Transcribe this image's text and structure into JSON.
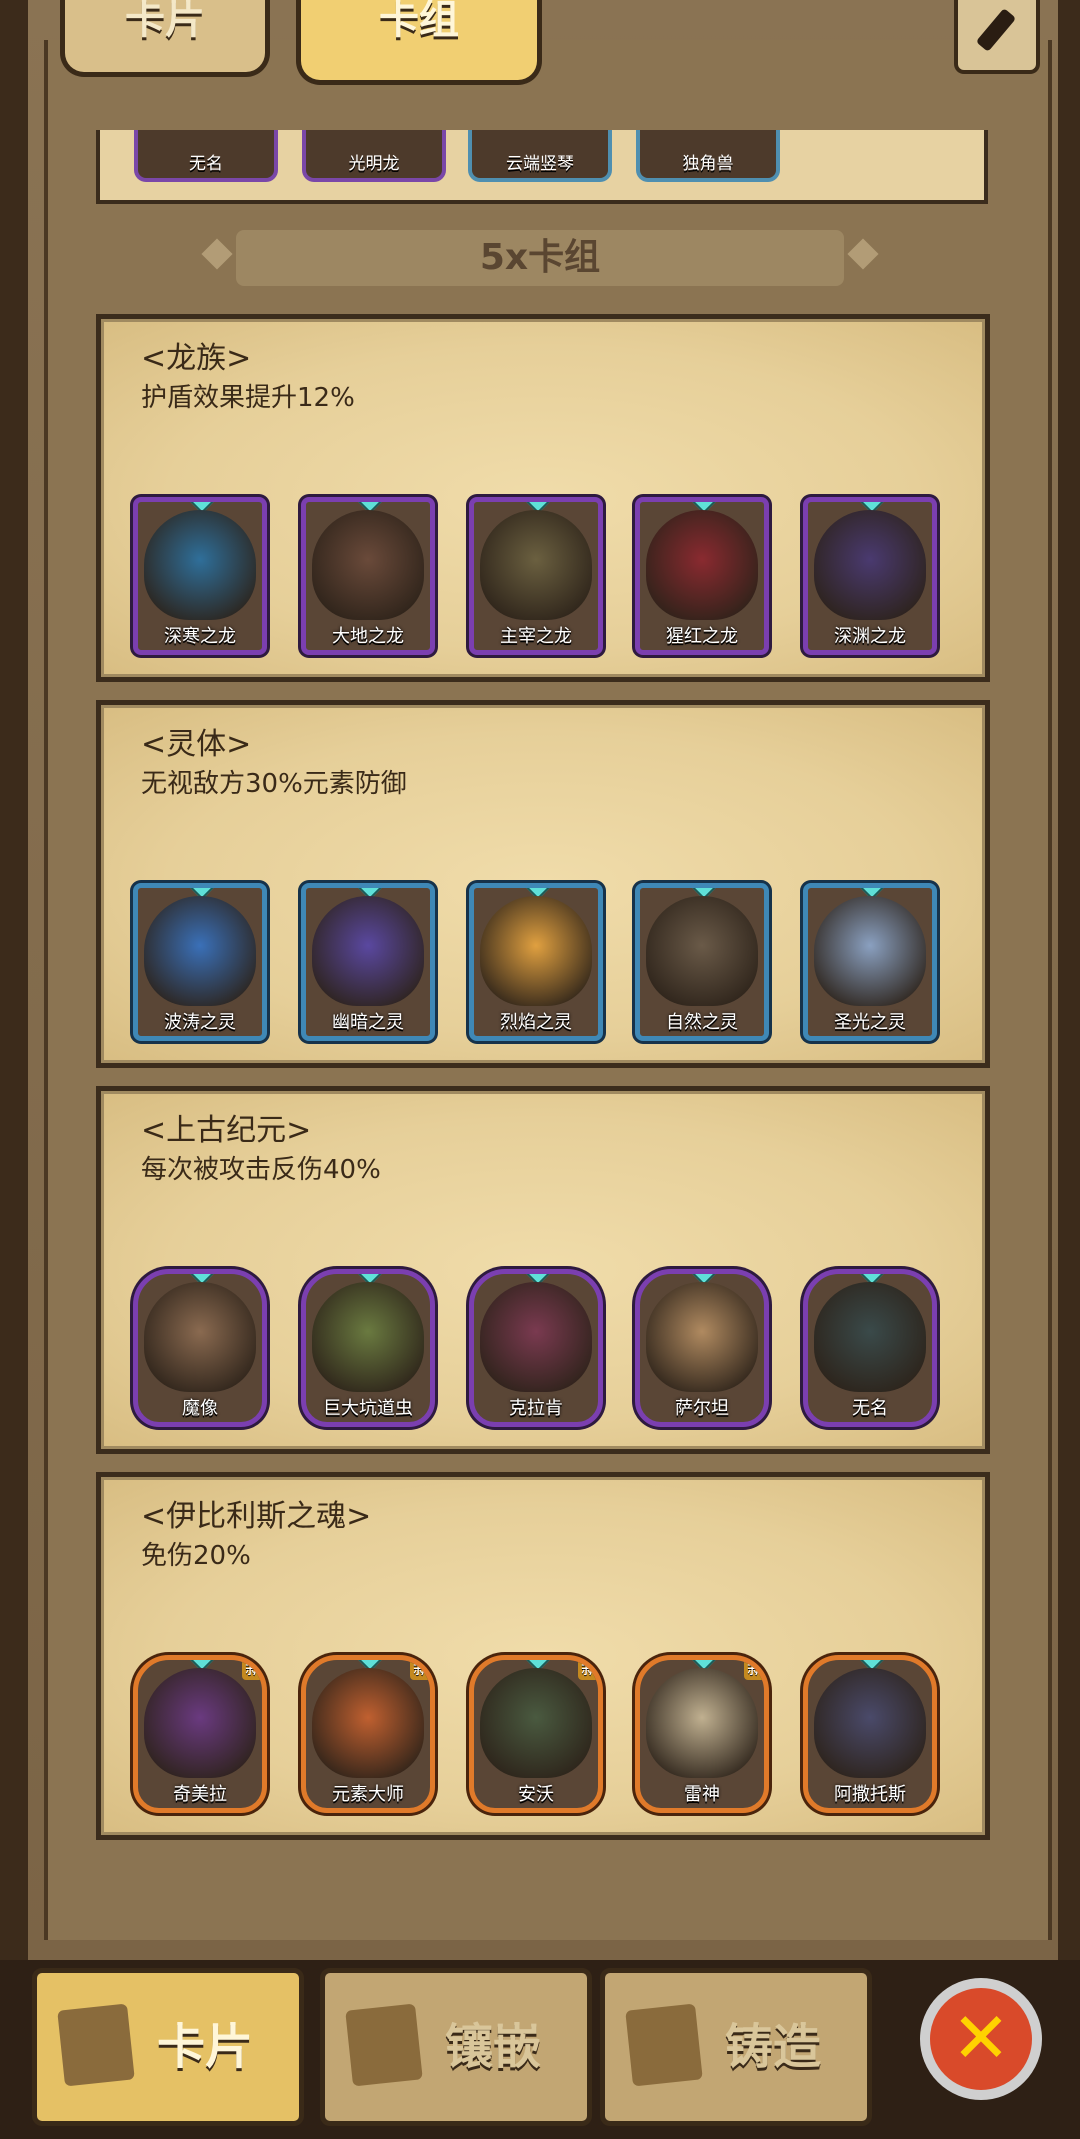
{
  "tabs": {
    "cards": "卡片",
    "deck": "卡组"
  },
  "prev_row": [
    "无名",
    "光明龙",
    "云端竖琴",
    "独角兽"
  ],
  "section_header": "5x卡组",
  "groups": [
    {
      "title": "<龙族>",
      "desc": "护盾效果提升12%",
      "frame": "purple",
      "cards": [
        "深寒之龙",
        "大地之龙",
        "主宰之龙",
        "猩红之龙",
        "深渊之龙"
      ],
      "arts": [
        "#2f6f9a",
        "#6a4a3a",
        "#6b6040",
        "#8a2a30",
        "#4a3a70"
      ]
    },
    {
      "title": "<灵体>",
      "desc": "无视敌方30%元素防御",
      "frame": "blue",
      "cards": [
        "波涛之灵",
        "幽暗之灵",
        "烈焰之灵",
        "自然之灵",
        "圣光之灵"
      ],
      "arts": [
        "#3a70b8",
        "#5a48a0",
        "#e0a040",
        "#6a5a48",
        "#8aa0c0"
      ]
    },
    {
      "title": "<上古纪元>",
      "desc": "每次被攻击反伤40%",
      "frame": "purple",
      "cards": [
        "魔像",
        "巨大坑道虫",
        "克拉肯",
        "萨尔坦",
        "无名"
      ],
      "arts": [
        "#8a6a50",
        "#6a7a40",
        "#7a3a50",
        "#b08a60",
        "#3a4a4a"
      ]
    },
    {
      "title": "<伊比利斯之魂>",
      "desc": "免伤20%",
      "frame": "orange",
      "cards": [
        "奇美拉",
        "元素大师",
        "安沃",
        "雷神",
        "阿撒托斯"
      ],
      "arts": [
        "#6a3a80",
        "#c06030",
        "#4a5a40",
        "#c0b090",
        "#4a4a6a"
      ],
      "new": [
        true,
        true,
        true,
        true,
        false
      ],
      "new_label": "新"
    }
  ],
  "bottom_nav": {
    "cards": "卡片",
    "inlay": "镶嵌",
    "forge": "铸造"
  },
  "close_symbol": "✕"
}
